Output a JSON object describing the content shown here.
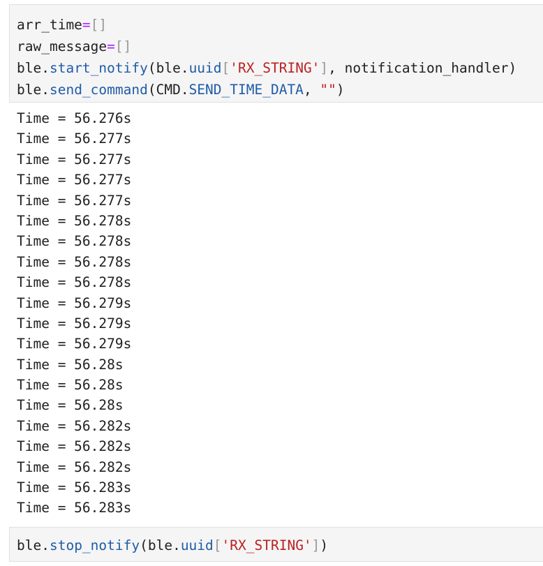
{
  "colors": {
    "operator": "#aa22ff",
    "bracket": "#999999",
    "attribute": "#1f5ca8",
    "string": "#ba2121",
    "text": "#212121",
    "cell_background": "#f5f5f5"
  },
  "cell1": {
    "line1": {
      "a": "arr_time",
      "b": "=",
      "c": "[]"
    },
    "line2": {
      "a": "raw_message",
      "b": "=",
      "c": "[]"
    },
    "line3": {
      "a": "ble.",
      "b": "start_notify",
      "c": "(ble.",
      "d": "uuid",
      "e": "[",
      "f": "'RX_STRING'",
      "g": "]",
      "h": ", notification_handler)"
    },
    "line4": {
      "a": "ble.",
      "b": "send_command",
      "c": "(CMD.",
      "d": "SEND_TIME_DATA",
      "e": ", ",
      "f": "\"\"",
      "g": ")"
    }
  },
  "output": {
    "lines": [
      "Time = 56.276s",
      "Time = 56.277s",
      "Time = 56.277s",
      "Time = 56.277s",
      "Time = 56.277s",
      "Time = 56.278s",
      "Time = 56.278s",
      "Time = 56.278s",
      "Time = 56.278s",
      "Time = 56.279s",
      "Time = 56.279s",
      "Time = 56.279s",
      "Time = 56.28s",
      "Time = 56.28s",
      "Time = 56.28s",
      "Time = 56.282s",
      "Time = 56.282s",
      "Time = 56.282s",
      "Time = 56.283s",
      "Time = 56.283s"
    ]
  },
  "cell2": {
    "line1": {
      "a": "ble.",
      "b": "stop_notify",
      "c": "(ble.",
      "d": "uuid",
      "e": "[",
      "f": "'RX_STRING'",
      "g": "]",
      "h": ")"
    }
  }
}
